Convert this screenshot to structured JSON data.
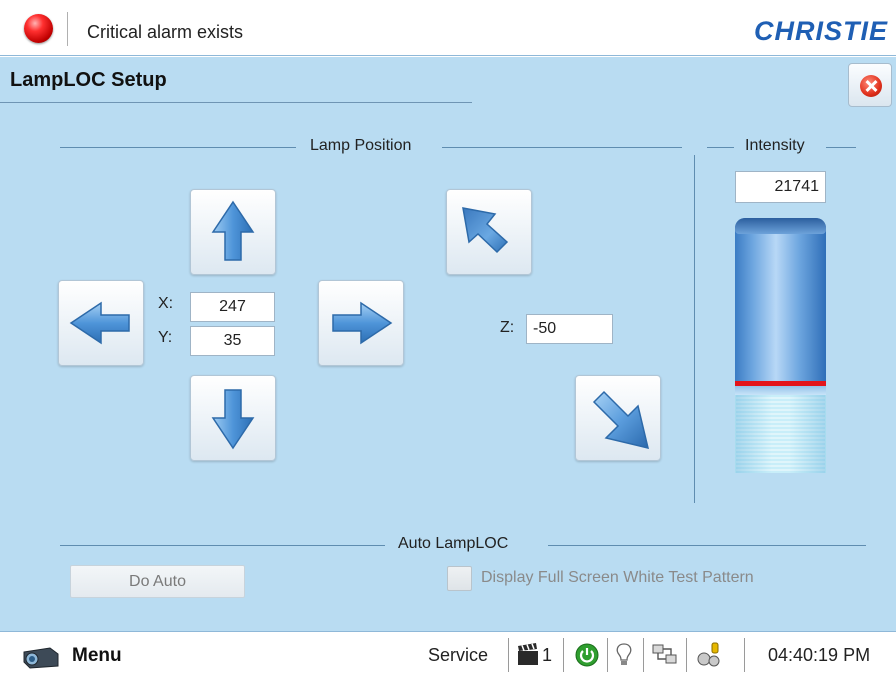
{
  "topbar": {
    "status_text": "Critical alarm exists",
    "logo_text": "CHRISTIE",
    "alarm_color": "#e00000"
  },
  "page": {
    "title": "LampLOC Setup",
    "close_icon": "close-icon"
  },
  "lamp_position": {
    "label": "Lamp Position",
    "x_label": "X:",
    "x_value": "247",
    "y_label": "Y:",
    "y_value": "35",
    "z_label": "Z:",
    "z_value": "-50",
    "buttons": {
      "up": "arrow-up-icon",
      "down": "arrow-down-icon",
      "left": "arrow-left-icon",
      "right": "arrow-right-icon",
      "z_in": "arrow-diagonal-in-icon",
      "z_out": "arrow-diagonal-out-icon"
    }
  },
  "intensity": {
    "label": "Intensity",
    "value": "21741",
    "level_color": "#e3141b"
  },
  "auto_lamploc": {
    "label": "Auto LampLOC",
    "do_auto_label": "Do Auto",
    "white_pattern_label": "Display Full Screen White Test Pattern",
    "white_pattern_checked": false
  },
  "taskbar": {
    "menu_label": "Menu",
    "service_label": "Service",
    "input_number": "1",
    "clock": "04:40:19 PM",
    "icons": [
      "projector-icon",
      "input-clapper-icon",
      "power-icon",
      "lamp-icon",
      "network-icon",
      "user-key-icon"
    ]
  }
}
